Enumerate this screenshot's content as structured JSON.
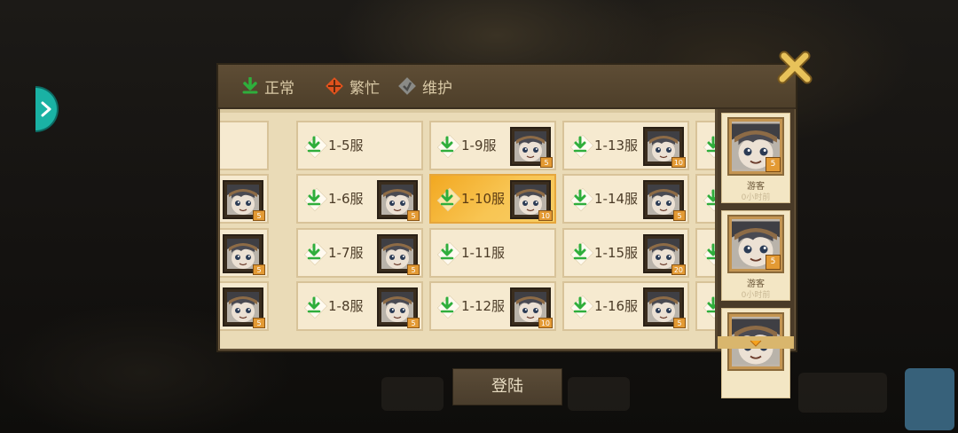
{
  "legend": [
    {
      "label": "正常",
      "icon": "normal-status-icon",
      "color": "#2fae3c"
    },
    {
      "label": "繁忙",
      "icon": "busy-status-icon",
      "color": "#e0521d"
    },
    {
      "label": "维护",
      "icon": "maintenance-status-icon",
      "color": "#8a8a86"
    }
  ],
  "servers": {
    "col0": [
      {
        "name": "",
        "level": ""
      },
      {
        "name": "",
        "level": "5"
      },
      {
        "name": "",
        "level": "5"
      },
      {
        "name": "",
        "level": "5"
      }
    ],
    "col1": [
      {
        "name": "1-5服",
        "level": ""
      },
      {
        "name": "1-6服",
        "level": "5"
      },
      {
        "name": "1-7服",
        "level": "5"
      },
      {
        "name": "1-8服",
        "level": "5"
      }
    ],
    "col2": [
      {
        "name": "1-9服",
        "level": "5"
      },
      {
        "name": "1-10服",
        "level": "10",
        "selected": true
      },
      {
        "name": "1-11服",
        "level": ""
      },
      {
        "name": "1-12服",
        "level": "10"
      }
    ],
    "col3": [
      {
        "name": "1-13服",
        "level": "10"
      },
      {
        "name": "1-14服",
        "level": "5"
      },
      {
        "name": "1-15服",
        "level": "20"
      },
      {
        "name": "1-16服",
        "level": "5"
      }
    ]
  },
  "recent": [
    {
      "name": "游客",
      "time": "0小时前",
      "level": "5"
    },
    {
      "name": "游客",
      "time": "0小时前",
      "level": "5"
    }
  ],
  "login_label": "登陆",
  "colors": {
    "normal": "#2fae3c",
    "busy": "#e0521d",
    "maintenance": "#8a8a86",
    "selected": "#f2a821"
  }
}
